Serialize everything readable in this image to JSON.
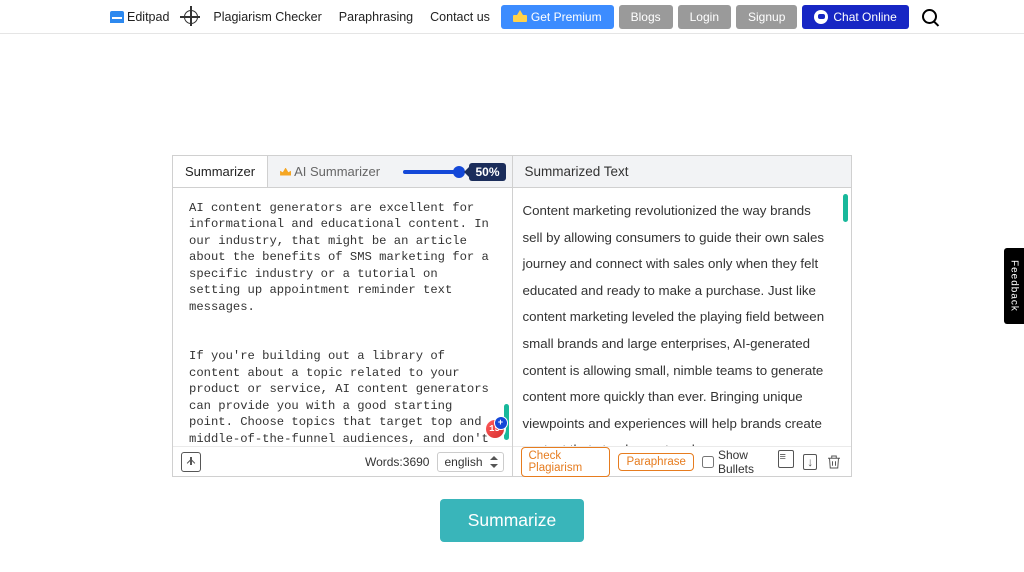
{
  "nav": {
    "brand": "Editpad",
    "links": {
      "plagiarism": "Plagiarism Checker",
      "paraphrasing": "Paraphrasing",
      "contact": "Contact us"
    },
    "premium": "Get Premium",
    "blogs": "Blogs",
    "login": "Login",
    "signup": "Signup",
    "chat": "Chat Online"
  },
  "tool": {
    "tab_summarizer": "Summarizer",
    "tab_ai": "AI Summarizer",
    "slider_pct": "50%",
    "input_text": "AI content generators are excellent for informational and educational content. In our industry, that might be an article about the benefits of SMS marketing for a specific industry or a tutorial on setting up appointment reminder text messages.\n\n\nIf you're building out a library of content about a topic related to your product or service, AI content generators can provide you with a good starting point. Choose topics that target top and middle-of-the-funnel audiences, and don't forget to fact-",
    "badge_count": "15",
    "words_label": "Words:",
    "words_count": "3690",
    "language": "english"
  },
  "output": {
    "header": "Summarized Text",
    "text": "Content marketing revolutionized the way brands sell by allowing consumers to guide their own sales journey and connect with sales only when they felt educated and ready to make a purchase.\nJust like content marketing leveled the playing field between small brands and large enterprises, AI-generated content is allowing small, nimble teams to generate content more quickly than ever.\nBringing unique viewpoints and experiences will help brands create content that stands apart and",
    "check_plag": "Check Plagiarism",
    "paraphrase": "Paraphrase",
    "show_bullets": "Show Bullets"
  },
  "main_button": "Summarize",
  "feedback": "Feedback"
}
